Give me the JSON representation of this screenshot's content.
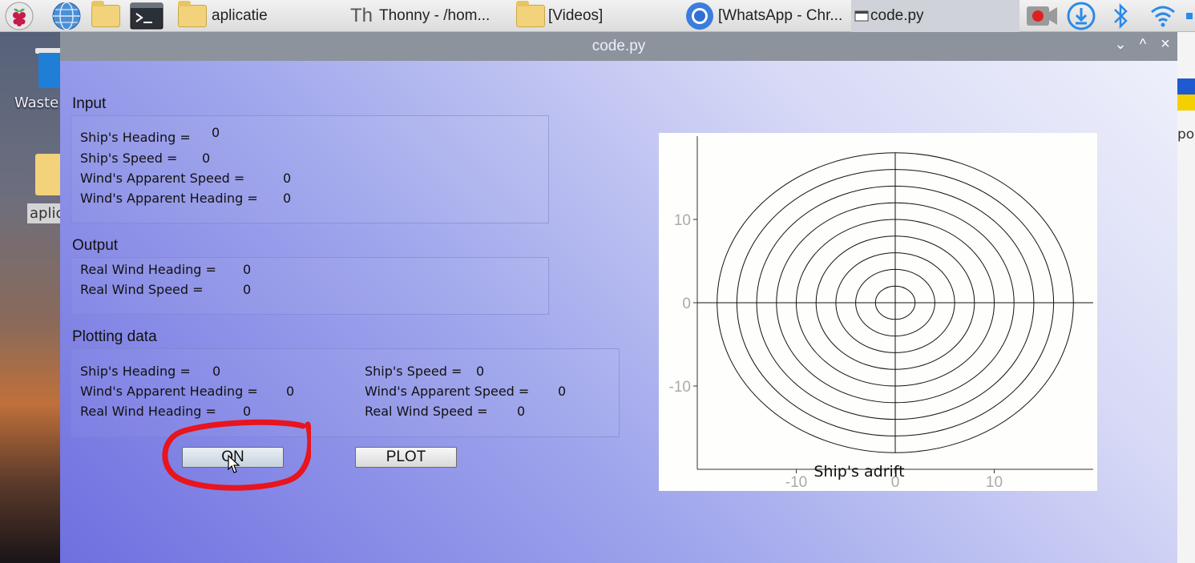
{
  "taskbar": {
    "tasks": [
      {
        "label": "aplicatie"
      },
      {
        "label": "Thonny  -  /hom..."
      },
      {
        "label": "[Videos]"
      },
      {
        "label": "[WhatsApp - Chr..."
      },
      {
        "label": "code.py"
      }
    ]
  },
  "desktop": {
    "trash_label": "Waste",
    "folder_label": "aplic",
    "right_edge_text": "por"
  },
  "window": {
    "title": "code.py",
    "controls": {
      "minimize": "⌄",
      "maximize": "^",
      "close": "×"
    }
  },
  "input": {
    "title": "Input",
    "ships_heading_label": "Ship's Heading =",
    "ships_heading_value": "0",
    "ships_speed_label": "Ship's Speed =",
    "ships_speed_value": "0",
    "wind_apparent_speed_label": "Wind's Apparent Speed =",
    "wind_apparent_speed_value": "0",
    "wind_apparent_heading_label": "Wind's Apparent Heading =",
    "wind_apparent_heading_value": "0"
  },
  "output": {
    "title": "Output",
    "real_wind_heading_label": "Real Wind Heading =",
    "real_wind_heading_value": "0",
    "real_wind_speed_label": "Real Wind Speed =",
    "real_wind_speed_value": "0"
  },
  "plotting": {
    "title": "Plotting data",
    "ships_heading_label": "Ship's Heading =",
    "ships_heading_value": "0",
    "ships_speed_label": "Ship's Speed =",
    "ships_speed_value": "0",
    "wind_apparent_heading_label": "Wind's Apparent Heading =",
    "wind_apparent_heading_value": "0",
    "wind_apparent_speed_label": "Wind's Apparent Speed =",
    "wind_apparent_speed_value": "0",
    "real_wind_heading_label": "Real Wind Heading =",
    "real_wind_heading_value": "0",
    "real_wind_speed_label": "Real Wind Speed =",
    "real_wind_speed_value": "0"
  },
  "buttons": {
    "on_label": "ON",
    "plot_label": "PLOT"
  },
  "colors": {
    "annotation": "#e8141e",
    "window_bg_start": "#6f6fe0",
    "window_bg_end": "#eef0fb"
  },
  "chart_data": {
    "type": "line",
    "title": "Ship's adrift",
    "xlabel": "",
    "ylabel": "",
    "xlim": [
      -20,
      20
    ],
    "ylim": [
      -20,
      20
    ],
    "xticks": [
      -10,
      0,
      10
    ],
    "yticks": [
      10,
      0,
      -10
    ],
    "grid": false,
    "series": [
      {
        "type": "concentric-circles",
        "center": [
          0,
          0
        ],
        "radii": [
          2,
          4,
          6,
          8,
          10,
          12,
          14,
          16,
          18
        ]
      },
      {
        "type": "axis-line",
        "x": [
          -20,
          20
        ],
        "y": [
          0,
          0
        ]
      },
      {
        "type": "axis-line",
        "x": [
          0,
          0
        ],
        "y": [
          -18,
          18
        ]
      }
    ]
  }
}
